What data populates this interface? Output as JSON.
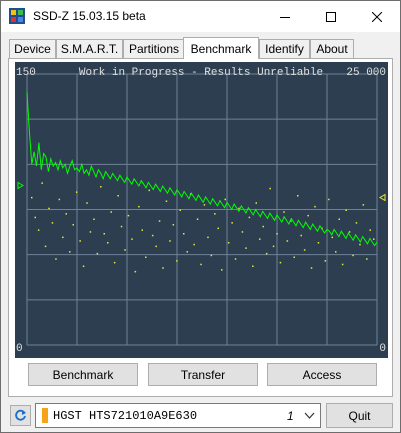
{
  "window": {
    "title": "SSD-Z 15.03.15 beta"
  },
  "tabs": [
    {
      "label": "Device"
    },
    {
      "label": "S.M.A.R.T."
    },
    {
      "label": "Partitions"
    },
    {
      "label": "Benchmark"
    },
    {
      "label": "Identify"
    },
    {
      "label": "About"
    }
  ],
  "active_tab": "Benchmark",
  "chart": {
    "banner": "Work in Progress - Results Unreliable",
    "y_left_max": "150",
    "y_left_min": "0",
    "y_right_max": "25 000",
    "y_right_min": "0",
    "colors": {
      "background": "#2c3e50",
      "grid": "#6f8298",
      "line": "#00ff00",
      "dots": "#e8e838",
      "text": "#e0e0e0"
    },
    "left_marker_value": 75,
    "right_marker_value": 12500
  },
  "chart_data": {
    "type": "line",
    "title": "Work in Progress - Results Unreliable",
    "xlabel": "",
    "ylabel": "",
    "ylim": [
      0,
      150
    ],
    "y2lim": [
      0,
      25000
    ],
    "grid": true,
    "series": [
      {
        "values": [
          140,
          118,
          100,
          107,
          99,
          112,
          97,
          106,
          104,
          96,
          103,
          99,
          101,
          97,
          102,
          98,
          100,
          95,
          99,
          102,
          97,
          98,
          96,
          100,
          95,
          97,
          94,
          99,
          96,
          93,
          97,
          95,
          92,
          96,
          94,
          92,
          95,
          93,
          91,
          94,
          92,
          90,
          93,
          91,
          89,
          92,
          90,
          88,
          91,
          89,
          87,
          90,
          88,
          86,
          89,
          87,
          85,
          88,
          86,
          84,
          87,
          85,
          83,
          86,
          84,
          82,
          85,
          83,
          81,
          84,
          82,
          80,
          83,
          81,
          79,
          82,
          80,
          78,
          81,
          79,
          77,
          80,
          78,
          76,
          79,
          77,
          75,
          78,
          76,
          74,
          77,
          75,
          73,
          76,
          74,
          72,
          75,
          73,
          71,
          74,
          72,
          70,
          73,
          71,
          69,
          72,
          70,
          68,
          71,
          69,
          67,
          70,
          68,
          66,
          69,
          67,
          65,
          68,
          66,
          64,
          67,
          65,
          63,
          66,
          64,
          62,
          64,
          63,
          61,
          64,
          62,
          60,
          63,
          61,
          59,
          62,
          60,
          58,
          61,
          59,
          57,
          60,
          58,
          56,
          59,
          57,
          55,
          57
        ]
      },
      {
        "values": [
          82,
          71,
          64,
          90,
          55,
          76,
          68,
          48,
          81,
          60,
          73,
          52,
          67,
          85,
          58,
          44,
          79,
          63,
          70,
          51,
          88,
          62,
          57,
          74,
          46,
          83,
          66,
          53,
          72,
          59,
          41,
          77,
          64,
          49,
          86,
          61,
          55,
          69,
          43,
          80,
          58,
          67,
          47,
          75,
          62,
          52,
          84,
          56,
          70,
          45,
          78,
          60,
          50,
          73,
          65,
          42,
          81,
          57,
          68,
          48,
          76,
          63,
          54,
          71,
          44,
          79,
          59,
          66,
          51,
          87,
          55,
          62,
          46,
          74,
          58,
          69,
          49,
          83,
          61,
          53,
          72,
          43,
          77,
          57,
          65,
          47,
          81,
          60,
          52,
          70,
          45,
          75,
          63,
          50,
          68,
          56,
          78,
          48,
          64,
          59
        ]
      }
    ]
  },
  "buttons": {
    "benchmark": "Benchmark",
    "transfer": "Transfer",
    "access": "Access"
  },
  "drive": {
    "name": "HGST HTS721010A9E630",
    "index": "1"
  },
  "quit_label": "Quit"
}
